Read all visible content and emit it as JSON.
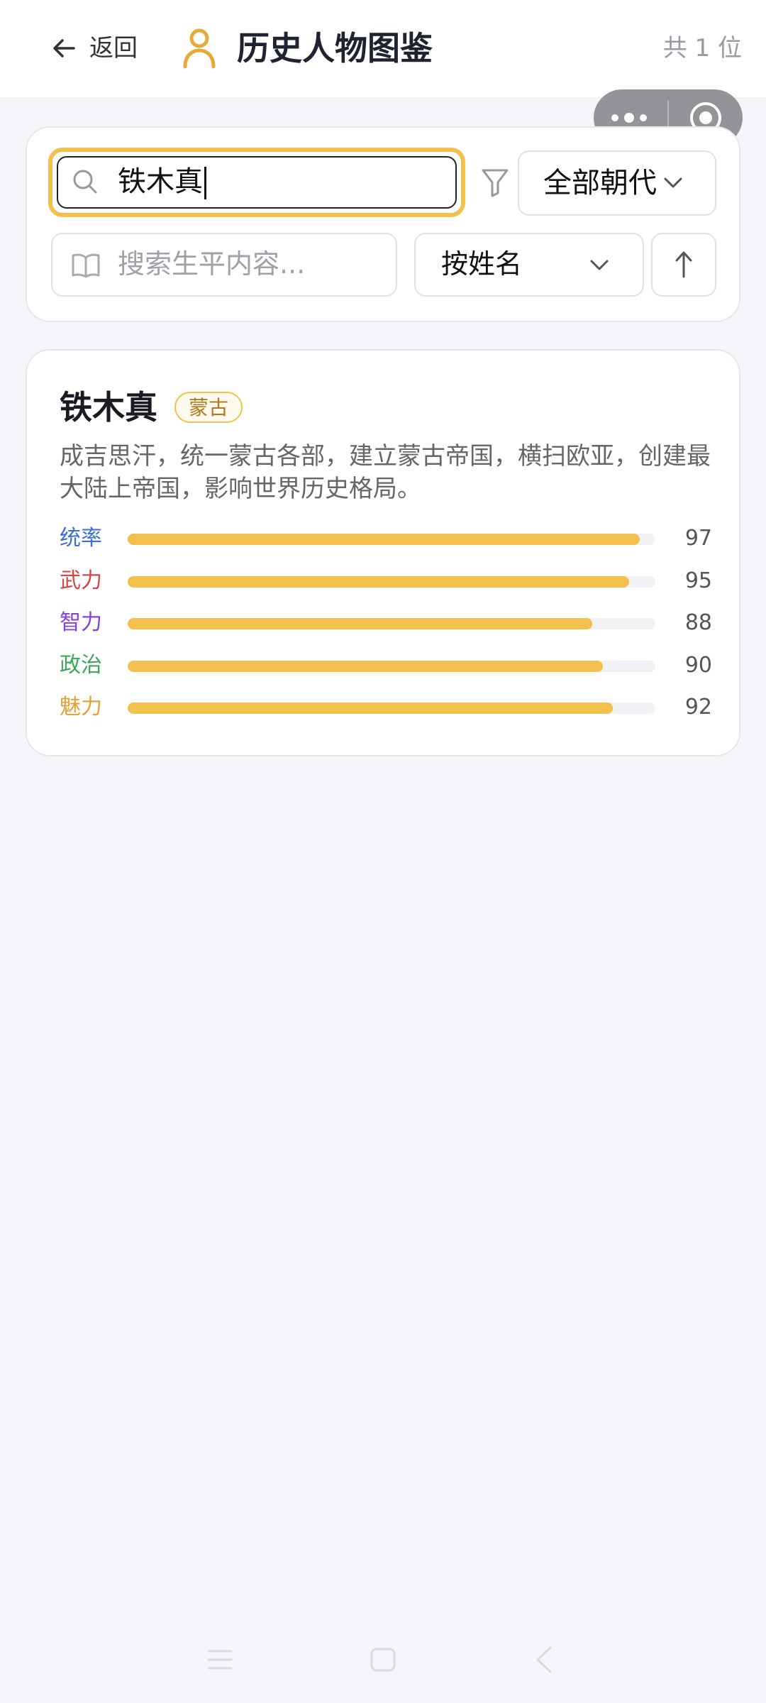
{
  "header": {
    "back_label": "返回",
    "title": "历史人物图鉴",
    "count_text": "共 1 位"
  },
  "filters": {
    "search_value": "铁木真",
    "dynasty_label": "全部朝代",
    "content_search_placeholder": "搜索生平内容...",
    "sort_label": "按姓名"
  },
  "characters": [
    {
      "name": "铁木真",
      "dynasty": "蒙古",
      "description": "成吉思汗，统一蒙古各部，建立蒙古帝国，横扫欧亚，创建最大陆上帝国，影响世界历史格局。",
      "stats": [
        {
          "label": "统率",
          "value": 97,
          "color": "#3c6fd6"
        },
        {
          "label": "武力",
          "value": 95,
          "color": "#d64545"
        },
        {
          "label": "智力",
          "value": 88,
          "color": "#8a3fd6"
        },
        {
          "label": "政治",
          "value": 90,
          "color": "#3ea858"
        },
        {
          "label": "魅力",
          "value": 92,
          "color": "#e3a132"
        }
      ]
    }
  ],
  "colors": {
    "accent": "#f0c24d",
    "bar_fill": "#f2c04c"
  }
}
